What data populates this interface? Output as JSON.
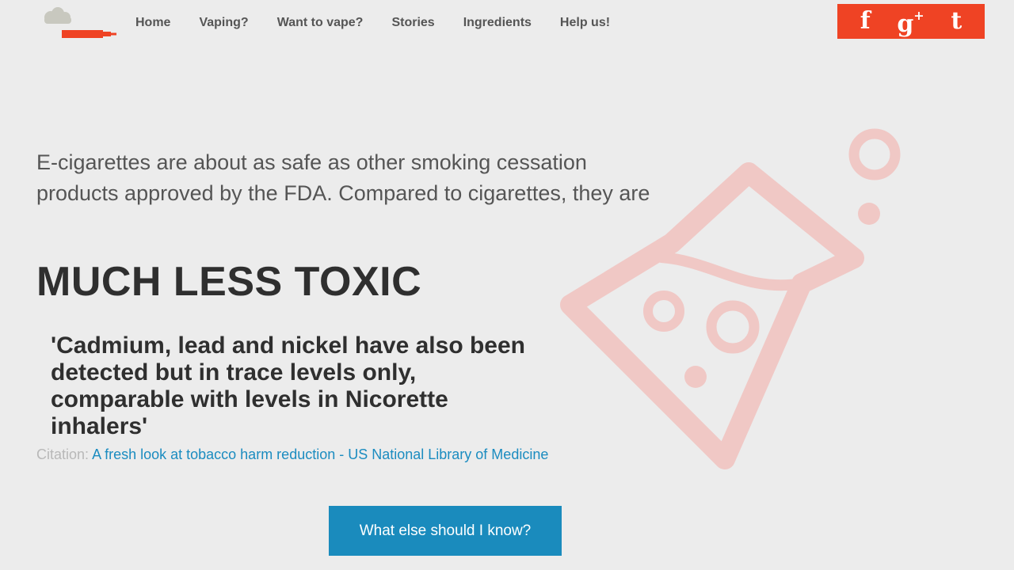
{
  "nav": {
    "items": [
      {
        "label": "Home"
      },
      {
        "label": "Vaping?"
      },
      {
        "label": "Want to vape?"
      },
      {
        "label": "Stories"
      },
      {
        "label": "Ingredients"
      },
      {
        "label": "Help us!"
      }
    ]
  },
  "social": {
    "facebook": "f",
    "gplus": "g",
    "gplus_sup": "+",
    "twitter": "t",
    "icons": [
      "facebook-icon",
      "google-plus-icon",
      "twitter-icon"
    ]
  },
  "main": {
    "intro": "E-cigarettes are about as safe as other smoking cessation products approved by the FDA. Compared to cigarettes, they are",
    "headline": "MUCH LESS TOXIC",
    "quote": "'Cadmium, lead and nickel have also been detected but in trace levels only, comparable with levels in Nicorette inhalers'",
    "citation_label": "Citation:",
    "citation_link": "A fresh look at tobacco harm reduction - US National Library of Medicine",
    "cta_label": "What else should I know?"
  },
  "colors": {
    "accent": "#ef4324",
    "link": "#1b8cc0",
    "button": "#1a8bbd",
    "background": "#ececec",
    "flask": "#f0c8c5"
  }
}
